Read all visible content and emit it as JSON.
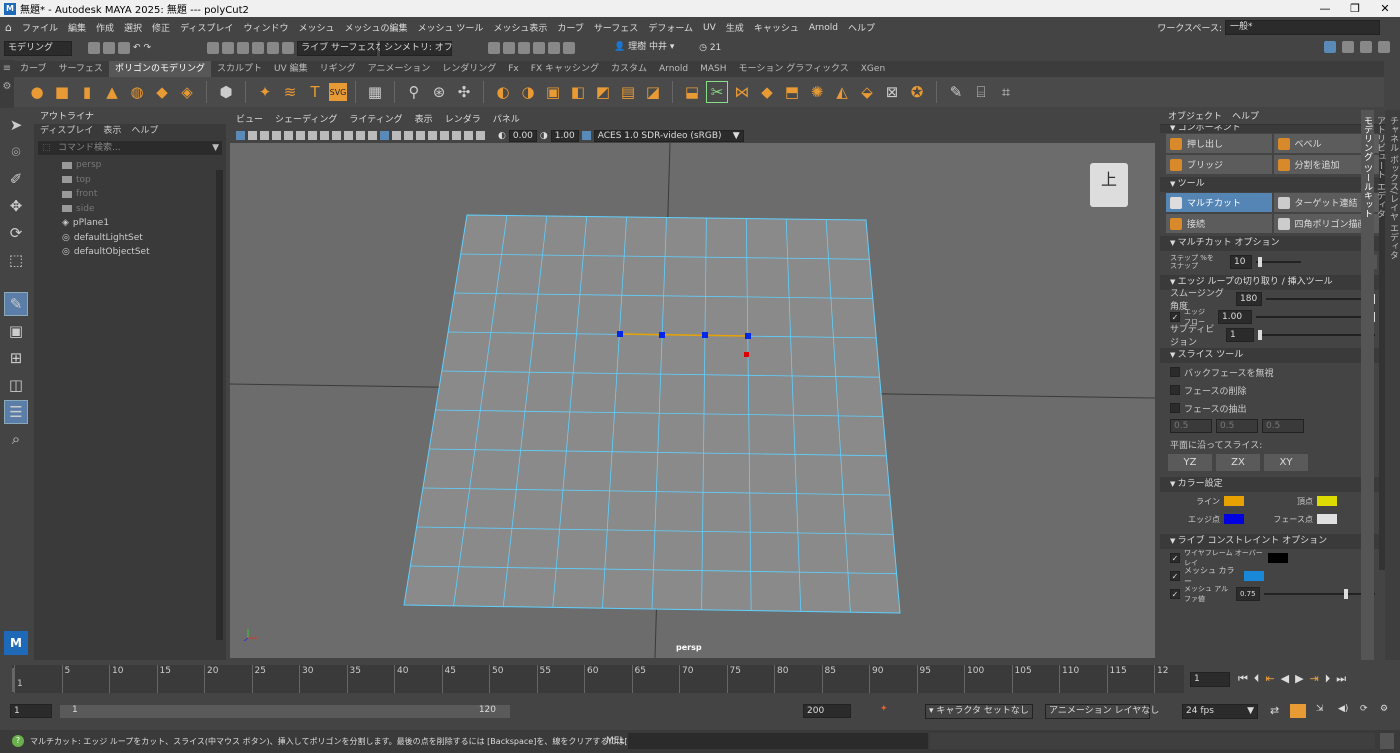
{
  "title": "無題* - Autodesk MAYA 2025: 無題   ---   polyCut2",
  "menus": [
    "ファイル",
    "編集",
    "作成",
    "選択",
    "修正",
    "ディスプレイ",
    "ウィンドウ",
    "メッシュ",
    "メッシュの編集",
    "メッシュ ツール",
    "メッシュ表示",
    "カーブ",
    "サーフェス",
    "デフォーム",
    "UV",
    "生成",
    "キャッシュ",
    "Arnold",
    "ヘルプ"
  ],
  "workspace": {
    "label": "ワークスペース:",
    "value": "一般*"
  },
  "statusline": {
    "menuset": "モデリング",
    "live": "ライブ  サーフェスなし",
    "symmetry": "シンメトリ: オフ",
    "user": "理樹 中井",
    "notifications": "21"
  },
  "shelf_tabs": [
    "カーブ",
    "サーフェス",
    "ポリゴンのモデリング",
    "スカルプト",
    "UV 編集",
    "リギング",
    "アニメーション",
    "レンダリング",
    "Fx",
    "FX キャッシング",
    "カスタム",
    "Arnold",
    "MASH",
    "モーション グラフィックス",
    "XGen"
  ],
  "shelf_active": "ポリゴンのモデリング",
  "outliner": {
    "title": "アウトライナ",
    "menu": [
      "ディスプレイ",
      "表示",
      "ヘルプ"
    ],
    "search_placeholder": "コマンド検索...",
    "items": [
      {
        "label": "persp",
        "dim": true
      },
      {
        "label": "top",
        "dim": true
      },
      {
        "label": "front",
        "dim": true
      },
      {
        "label": "side",
        "dim": true
      },
      {
        "label": "pPlane1",
        "dim": false
      },
      {
        "label": "defaultLightSet",
        "dim": false
      },
      {
        "label": "defaultObjectSet",
        "dim": false
      }
    ]
  },
  "viewport": {
    "menu": [
      "ビュー",
      "シェーディング",
      "ライティング",
      "表示",
      "レンダラ",
      "パネル"
    ],
    "exposure": "0.00",
    "gamma": "1.00",
    "colorspace": "ACES 1.0 SDR-video (sRGB)",
    "camera_label": "persp",
    "viewcube": "上"
  },
  "modeling_toolkit": {
    "menu": [
      "オブジェクト",
      "ヘルプ"
    ],
    "component_header": "コンポーネント",
    "tools_a": [
      [
        "押し出し",
        "ベベル"
      ],
      [
        "ブリッジ",
        "分割を追加"
      ]
    ],
    "tools_header": "ツール",
    "tools_b": [
      [
        "マルチカット",
        "ターゲット連結"
      ],
      [
        "接続",
        "四角ポリゴン描画"
      ]
    ],
    "active_tool": "マルチカット",
    "multicut_options": "マルチカット オプション",
    "snap_step_label": "ステップ %を",
    "snap_step_label2": "スナップ",
    "snap_step": "10",
    "help_button": "?",
    "edgeloop_header": "エッジ ループの切り取り / 挿入ツール",
    "smoothing_label": "スムージング角度",
    "smoothing": "180",
    "edgeflow_label": "エッジ フロー",
    "edgeflow": "1.00",
    "subdiv_label": "サブディビジョン",
    "subdiv": "1",
    "slice_header": "スライス ツール",
    "slice_opts": [
      "バックフェースを無視",
      "フェースの削除",
      "フェースの抽出"
    ],
    "slice_values": [
      "0.5",
      "0.5",
      "0.5"
    ],
    "slice_plane_label": "平面に沿ってスライス:",
    "planes": [
      "YZ",
      "ZX",
      "XY"
    ],
    "color_header": "カラー設定",
    "line_label": "ライン",
    "vertex_label": "頂点",
    "edge_point_label": "エッジ点",
    "face_point_label": "フェース点",
    "line_color": "#e8a200",
    "vertex_color": "#dcdc00",
    "edge_point_color": "#0000e0",
    "face_point_color": "#e0e0e0",
    "live_header": "ライブ コンストレイント オプション",
    "wire_label": "ワイヤフレーム オーバーレイ",
    "wire_color": "#000000",
    "mesh_color_label": "メッシュ カラー",
    "mesh_color": "#1a88d8",
    "mesh_alpha_label": "メッシュ アルファ値",
    "mesh_alpha": "0.75"
  },
  "side_tabs": [
    "チャネル ボックス/レイヤ エディタ",
    "アトリビュート エディタ",
    "モデリング ツールキット"
  ],
  "timeline": {
    "ticks": [
      "1",
      "5",
      "10",
      "15",
      "20",
      "25",
      "30",
      "35",
      "40",
      "45",
      "50",
      "55",
      "60",
      "65",
      "70",
      "75",
      "80",
      "85",
      "90",
      "95",
      "100",
      "105",
      "110",
      "115",
      "12"
    ],
    "current": "1",
    "range_start": "1",
    "range_inner_start": "1",
    "range_inner_end": "120",
    "range_end": "200",
    "character": "キャラクタ セットなし",
    "anim_layer": "アニメーション レイヤなし",
    "fps": "24 fps"
  },
  "help_line": "マルチカット: エッジ ループをカット、スライス(中マウス ボタン)、挿入してポリゴンを分割します。最後の点を削除するには [Backspace]を、線をクリアするには[Esc]を押します。",
  "script_lang": "MEL"
}
